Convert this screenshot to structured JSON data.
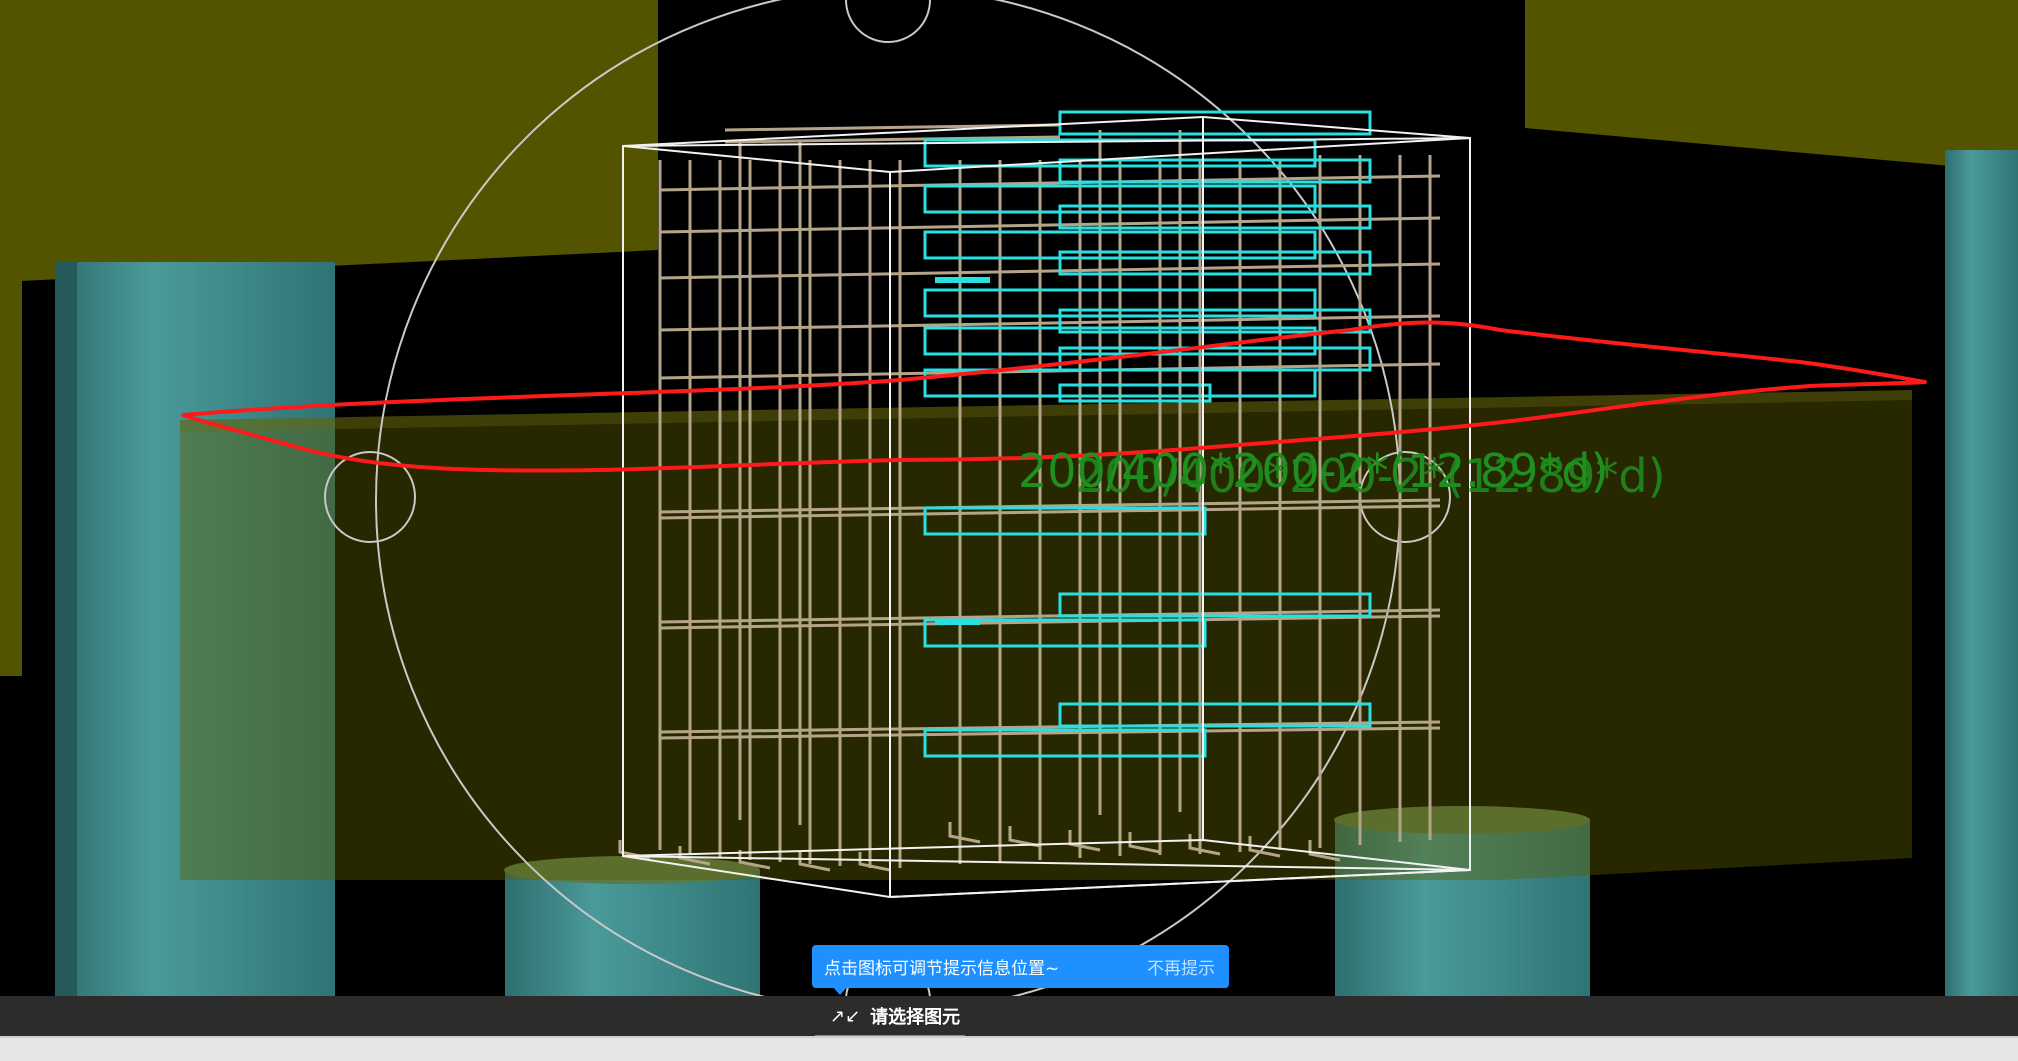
{
  "viewport": {
    "dimension_label": "200/400*200-2*(12.89*d)",
    "colors": {
      "background": "#000000",
      "slab": "#5a5a00",
      "column": "#3e8c8c",
      "rebar": "#b4a58a",
      "rebar_highlight": "#29e0e0",
      "frame": "#f2f2f2",
      "markup": "#ff1a1a",
      "dimension_text": "#1f8f1f"
    }
  },
  "tooltip": {
    "message": "点击图标可调节提示信息位置~",
    "dismiss_label": "不再提示"
  },
  "status": {
    "prompt": "请选择图元",
    "cursor_icon": "select-cursor-icon"
  }
}
